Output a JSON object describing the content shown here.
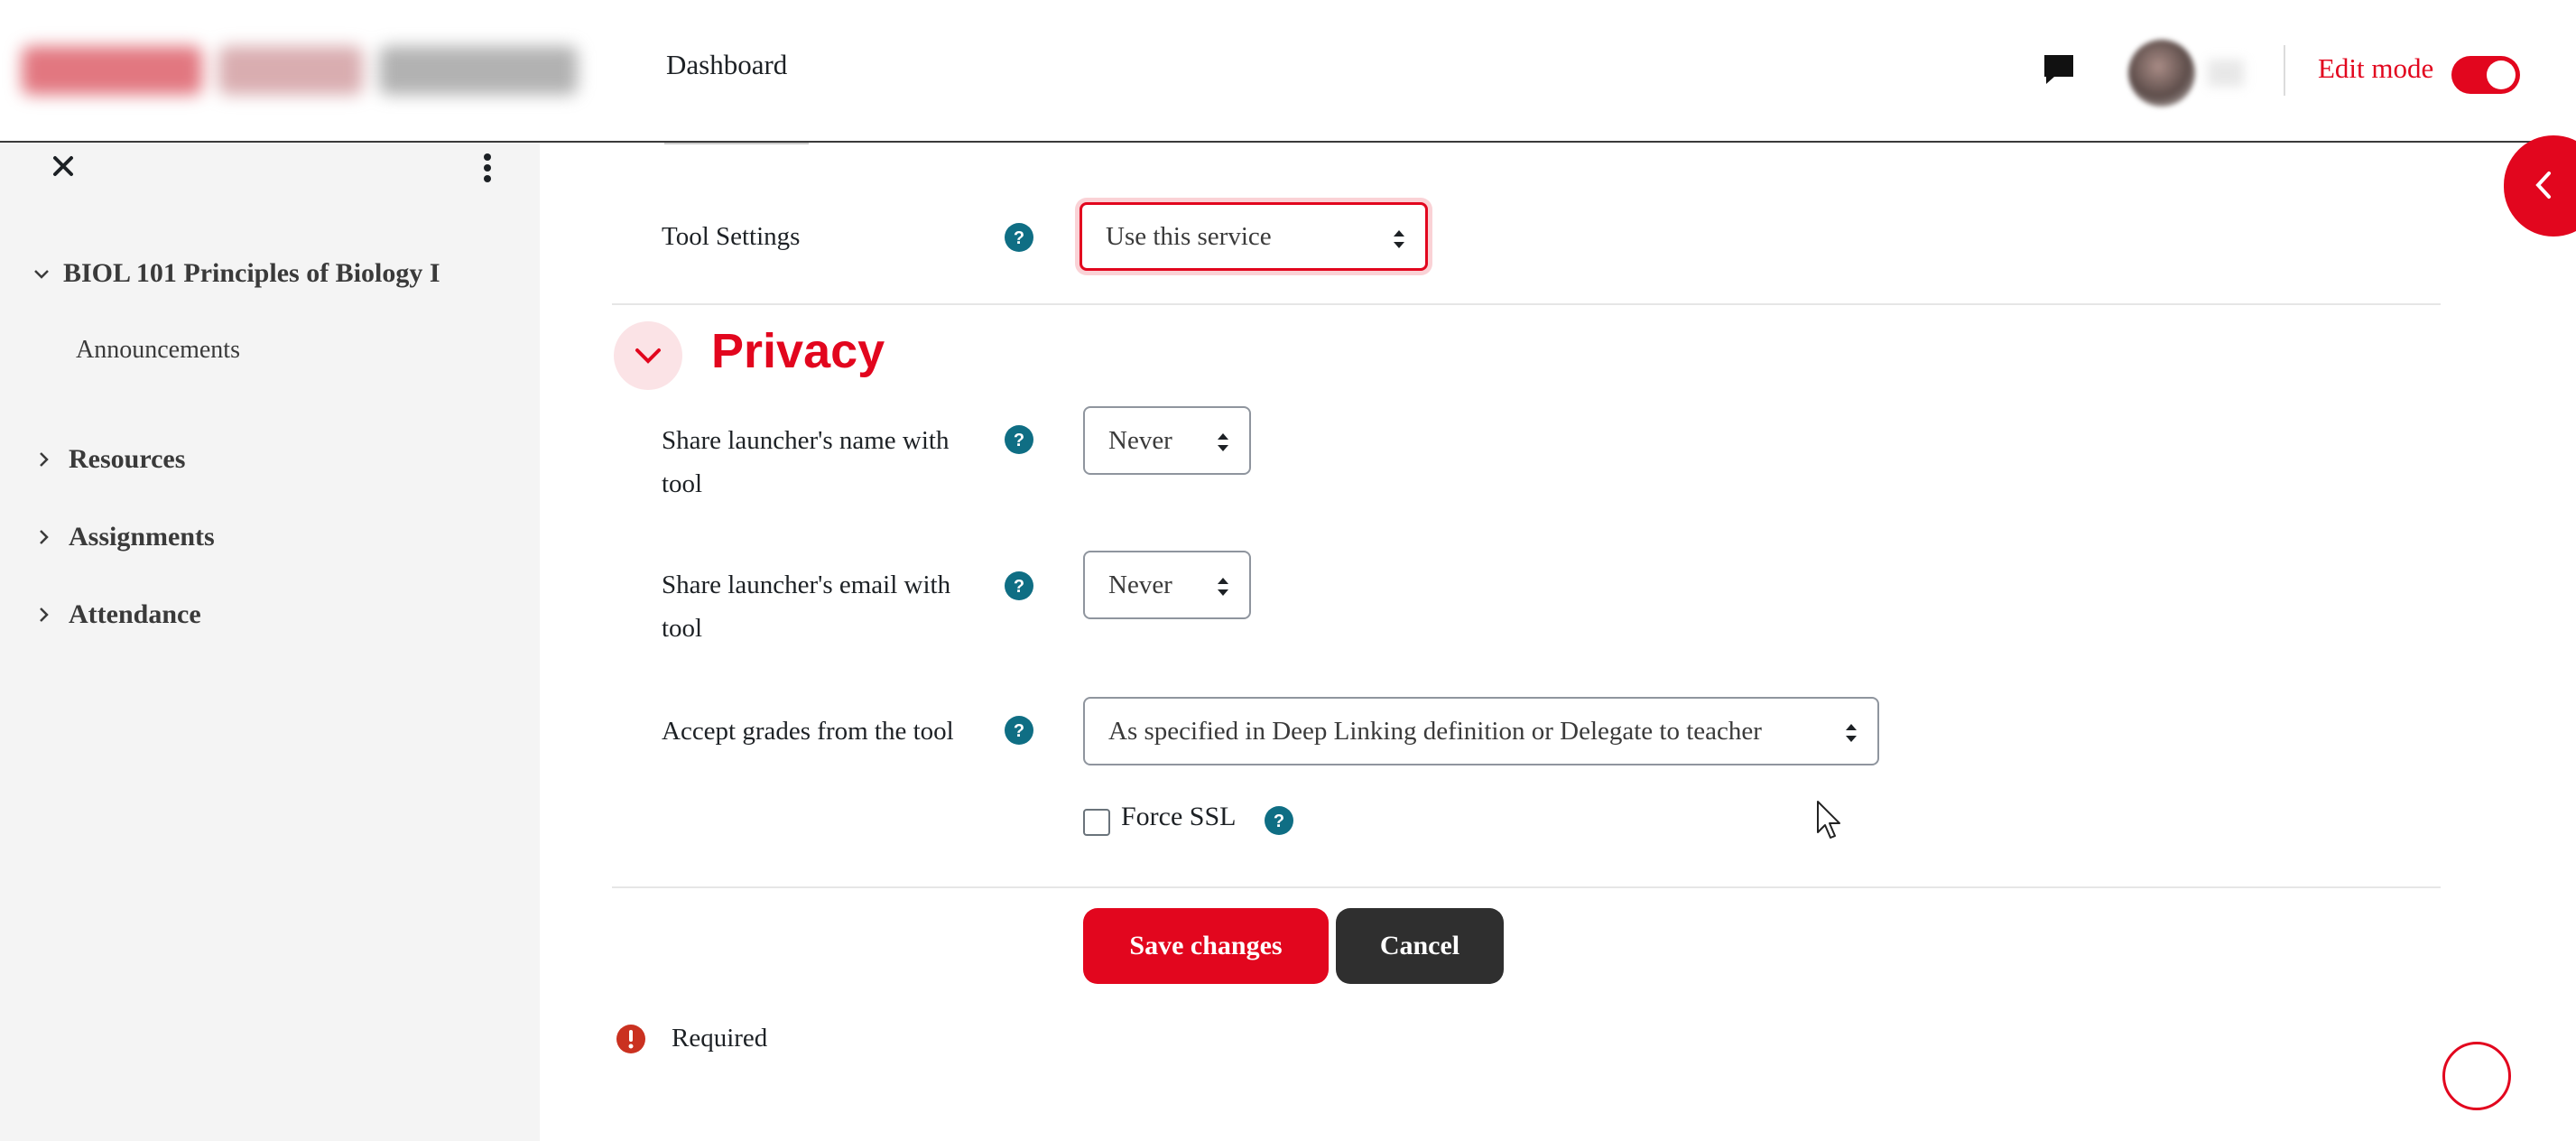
{
  "navbar": {
    "dashboard_label": "Dashboard",
    "edit_mode_label": "Edit mode",
    "edit_mode_on": true
  },
  "drawer": {
    "course_title": "BIOL 101 Principles of Biology I",
    "course_items": [
      "Announcements"
    ],
    "sections": [
      "Resources",
      "Assignments",
      "Attendance"
    ]
  },
  "form": {
    "tool_settings": {
      "label": "Tool Settings",
      "value": "Use this service"
    },
    "privacy": {
      "heading": "Privacy",
      "share_name": {
        "label": "Share launcher's name with tool",
        "value": "Never"
      },
      "share_email": {
        "label": "Share launcher's email with tool",
        "value": "Never"
      },
      "accept_grades": {
        "label": "Accept grades from the tool",
        "value": "As specified in Deep Linking definition or Delegate to teacher"
      },
      "force_ssl": {
        "label": "Force SSL",
        "checked": false
      }
    },
    "buttons": {
      "save": "Save changes",
      "cancel": "Cancel"
    },
    "required_label": "Required"
  },
  "colors": {
    "brand_red": "#e2061e",
    "help_teal": "#0f6e84",
    "dark_button": "#2f2f2f",
    "drawer_bg": "#f4f4f4"
  },
  "icons": [
    "chat-icon",
    "close-icon",
    "kebab-icon",
    "chevron-down-icon",
    "chevron-right-icon",
    "chevron-left-icon",
    "help-icon",
    "required-icon",
    "mouse-cursor-icon"
  ]
}
